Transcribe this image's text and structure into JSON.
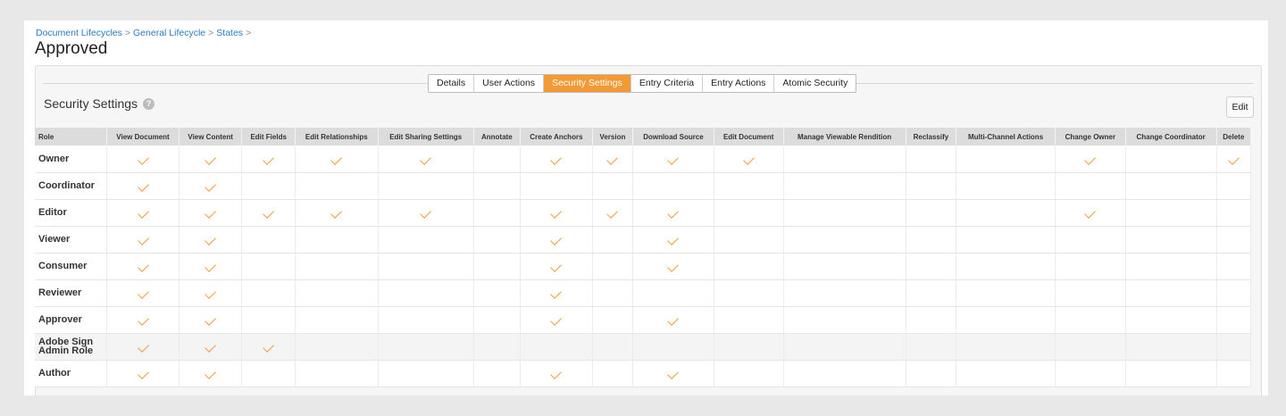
{
  "breadcrumb": {
    "items": [
      "Document Lifecycles",
      "General Lifecycle",
      "States"
    ],
    "separator": ">"
  },
  "page_title": "Approved",
  "tabs": [
    {
      "label": "Details",
      "active": false
    },
    {
      "label": "User Actions",
      "active": false
    },
    {
      "label": "Security Settings",
      "active": true
    },
    {
      "label": "Entry Criteria",
      "active": false
    },
    {
      "label": "Entry Actions",
      "active": false
    },
    {
      "label": "Atomic Security",
      "active": false
    }
  ],
  "section": {
    "title": "Security Settings",
    "help_icon": "question-circle-icon",
    "edit_label": "Edit"
  },
  "colors": {
    "accent": "#f39a35",
    "link": "#2a7bc0"
  },
  "table": {
    "columns": [
      "Role",
      "View Document",
      "View Content",
      "Edit Fields",
      "Edit Relationships",
      "Edit Sharing Settings",
      "Annotate",
      "Create Anchors",
      "Version",
      "Download Source",
      "Edit Document",
      "Manage Viewable Rendition",
      "Reclassify",
      "Multi-Channel Actions",
      "Change Owner",
      "Change Coordinator",
      "Delete"
    ],
    "rows": [
      {
        "role": "Owner",
        "checks": [
          1,
          1,
          1,
          1,
          1,
          0,
          1,
          1,
          1,
          1,
          0,
          0,
          0,
          1,
          0,
          1
        ]
      },
      {
        "role": "Coordinator",
        "checks": [
          1,
          1,
          0,
          0,
          0,
          0,
          0,
          0,
          0,
          0,
          0,
          0,
          0,
          0,
          0,
          0
        ]
      },
      {
        "role": "Editor",
        "checks": [
          1,
          1,
          1,
          1,
          1,
          0,
          1,
          1,
          1,
          0,
          0,
          0,
          0,
          1,
          0,
          0
        ]
      },
      {
        "role": "Viewer",
        "checks": [
          1,
          1,
          0,
          0,
          0,
          0,
          1,
          0,
          1,
          0,
          0,
          0,
          0,
          0,
          0,
          0
        ]
      },
      {
        "role": "Consumer",
        "checks": [
          1,
          1,
          0,
          0,
          0,
          0,
          1,
          0,
          1,
          0,
          0,
          0,
          0,
          0,
          0,
          0
        ]
      },
      {
        "role": "Reviewer",
        "checks": [
          1,
          1,
          0,
          0,
          0,
          0,
          1,
          0,
          0,
          0,
          0,
          0,
          0,
          0,
          0,
          0
        ]
      },
      {
        "role": "Approver",
        "checks": [
          1,
          1,
          0,
          0,
          0,
          0,
          1,
          0,
          1,
          0,
          0,
          0,
          0,
          0,
          0,
          0
        ]
      },
      {
        "role": "Adobe Sign Admin Role",
        "checks": [
          1,
          1,
          1,
          0,
          0,
          0,
          0,
          0,
          0,
          0,
          0,
          0,
          0,
          0,
          0,
          0
        ]
      },
      {
        "role": "Author",
        "checks": [
          1,
          1,
          0,
          0,
          0,
          0,
          1,
          0,
          1,
          0,
          0,
          0,
          0,
          0,
          0,
          0
        ]
      }
    ]
  }
}
